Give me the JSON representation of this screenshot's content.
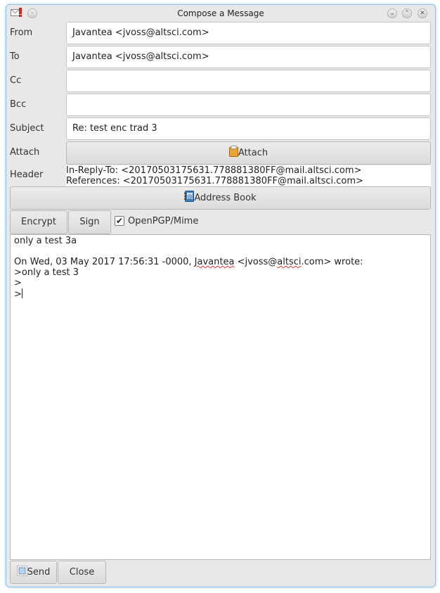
{
  "window": {
    "title": "Compose a Message",
    "icons": [
      "mail-alert-icon",
      "pin-icon"
    ],
    "controls": [
      "minimize-icon",
      "maximize-icon",
      "close-icon"
    ]
  },
  "fields": {
    "from": {
      "label": "From",
      "value": "Javantea <jvoss@altsci.com>"
    },
    "to": {
      "label": "To",
      "value": "Javantea <jvoss@altsci.com>"
    },
    "cc": {
      "label": "Cc",
      "value": ""
    },
    "bcc": {
      "label": "Bcc",
      "value": ""
    },
    "subject": {
      "label": "Subject",
      "value": "Re: test enc trad 3"
    },
    "attach": {
      "label": "Attach",
      "button": "Attach"
    },
    "header": {
      "label": "Header",
      "lines": [
        "In-Reply-To: <20170503175631.778881380FF@mail.altsci.com>",
        "References: <20170503175631.778881380FF@mail.altsci.com>"
      ]
    }
  },
  "address_book_button": "Address Book",
  "security": {
    "encrypt": "Encrypt",
    "sign": "Sign",
    "openpgp_mime": {
      "label": "OpenPGP/Mime",
      "checked": true
    }
  },
  "body": {
    "line1": "only a test 3a",
    "line2": "",
    "line3_pre": "On Wed, 03 May 2017 17:56:31 -0000, ",
    "line3_name": "Javantea",
    "line3_mid": " <jvoss@",
    "line3_domain": "altsci",
    "line3_post": ".com> wrote:",
    "line4": ">only a test 3",
    "line5": ">",
    "line6": ">"
  },
  "footer": {
    "send": "Send",
    "close": "Close"
  }
}
